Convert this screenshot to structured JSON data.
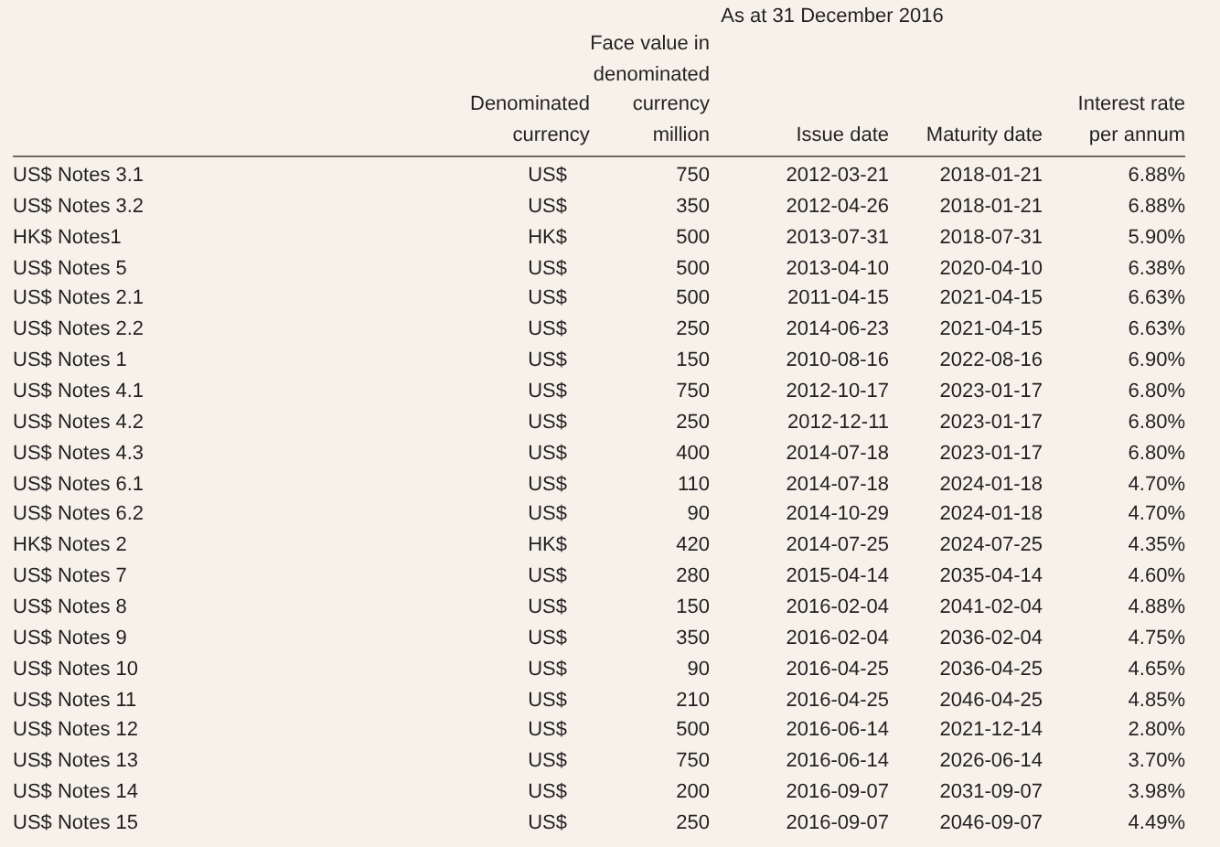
{
  "caption": "As at 31 December 2016",
  "columns": [
    "",
    "Denominated\ncurrency",
    "Face value in\ndenominated\ncurrency\nmillion",
    "Issue date",
    "Maturity date",
    "Interest rate\nper annum"
  ],
  "rows": [
    [
      "US$ Notes 3.1",
      "US$",
      "750",
      "2012-03-21",
      "2018-01-21",
      "6.88%"
    ],
    [
      "US$ Notes 3.2",
      "US$",
      "350",
      "2012-04-26",
      "2018-01-21",
      "6.88%"
    ],
    [
      "HK$ Notes1",
      "HK$",
      "500",
      "2013-07-31",
      "2018-07-31",
      "5.90%"
    ],
    [
      "US$ Notes 5",
      "US$",
      "500",
      "2013-04-10",
      "2020-04-10",
      "6.38%"
    ],
    [
      "US$ Notes 2.1",
      "US$",
      "500",
      "2011-04-15",
      "2021-04-15",
      "6.63%"
    ],
    [
      "US$ Notes 2.2",
      "US$",
      "250",
      "2014-06-23",
      "2021-04-15",
      "6.63%"
    ],
    [
      "US$ Notes 1",
      "US$",
      "150",
      "2010-08-16",
      "2022-08-16",
      "6.90%"
    ],
    [
      "US$ Notes 4.1",
      "US$",
      "750",
      "2012-10-17",
      "2023-01-17",
      "6.80%"
    ],
    [
      "US$ Notes 4.2",
      "US$",
      "250",
      "2012-12-11",
      "2023-01-17",
      "6.80%"
    ],
    [
      "US$ Notes 4.3",
      "US$",
      "400",
      "2014-07-18",
      "2023-01-17",
      "6.80%"
    ],
    [
      "US$ Notes 6.1",
      "US$",
      "110",
      "2014-07-18",
      "2024-01-18",
      "4.70%"
    ],
    [
      "US$ Notes 6.2",
      "US$",
      "90",
      "2014-10-29",
      "2024-01-18",
      "4.70%"
    ],
    [
      "HK$ Notes 2",
      "HK$",
      "420",
      "2014-07-25",
      "2024-07-25",
      "4.35%"
    ],
    [
      "US$ Notes 7",
      "US$",
      "280",
      "2015-04-14",
      "2035-04-14",
      "4.60%"
    ],
    [
      "US$ Notes 8",
      "US$",
      "150",
      "2016-02-04",
      "2041-02-04",
      "4.88%"
    ],
    [
      "US$ Notes 9",
      "US$",
      "350",
      "2016-02-04",
      "2036-02-04",
      "4.75%"
    ],
    [
      "US$ Notes 10",
      "US$",
      "90",
      "2016-04-25",
      "2036-04-25",
      "4.65%"
    ],
    [
      "US$ Notes 11",
      "US$",
      "210",
      "2016-04-25",
      "2046-04-25",
      "4.85%"
    ],
    [
      "US$ Notes 12",
      "US$",
      "500",
      "2016-06-14",
      "2021-12-14",
      "2.80%"
    ],
    [
      "US$ Notes 13",
      "US$",
      "750",
      "2016-06-14",
      "2026-06-14",
      "3.70%"
    ],
    [
      "US$ Notes 14",
      "US$",
      "200",
      "2016-09-07",
      "2031-09-07",
      "3.98%"
    ],
    [
      "US$ Notes 15",
      "US$",
      "250",
      "2016-09-07",
      "2046-09-07",
      "4.49%"
    ]
  ]
}
